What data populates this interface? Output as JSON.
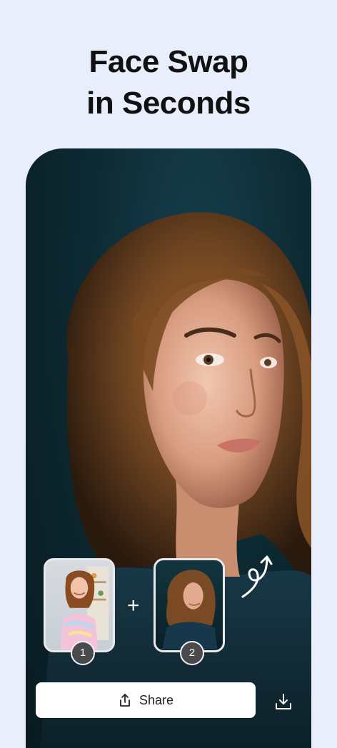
{
  "headline": {
    "line1": "Face Swap",
    "line2": "in Seconds"
  },
  "result_image": {
    "icon": "portrait-photo"
  },
  "source_photos": [
    {
      "badge": "1"
    },
    {
      "badge": "2"
    }
  ],
  "combine_symbol": "+",
  "actions": {
    "share_label": "Share",
    "share_icon": "share-icon",
    "download_icon": "download-icon"
  },
  "colors": {
    "background": "#e9eefc",
    "photo_background": "#0d2a33",
    "button": "#ffffff",
    "badge": "#4a4a4d"
  }
}
